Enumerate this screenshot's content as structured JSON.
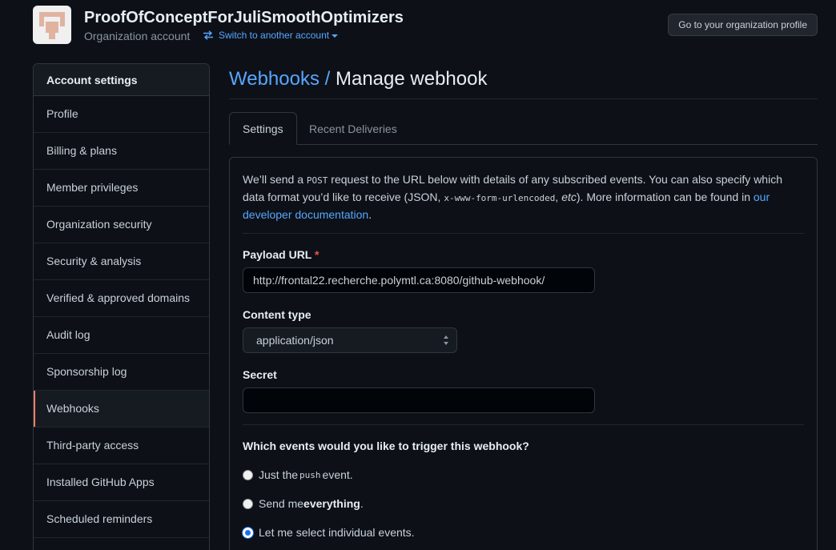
{
  "header": {
    "org_name": "ProofOfConceptForJuliSmoothOptimizers",
    "org_type": "Organization account",
    "switch_account_label": "Switch to another account",
    "profile_button_label": "Go to your organization profile"
  },
  "sidebar": {
    "heading": "Account settings",
    "items": [
      {
        "label": "Profile"
      },
      {
        "label": "Billing & plans"
      },
      {
        "label": "Member privileges"
      },
      {
        "label": "Organization security"
      },
      {
        "label": "Security & analysis"
      },
      {
        "label": "Verified & approved domains"
      },
      {
        "label": "Audit log"
      },
      {
        "label": "Sponsorship log"
      },
      {
        "label": "Webhooks",
        "selected": true
      },
      {
        "label": "Third-party access"
      },
      {
        "label": "Installed GitHub Apps"
      },
      {
        "label": "Scheduled reminders"
      }
    ]
  },
  "main": {
    "breadcrumb_link": "Webhooks",
    "breadcrumb_separator": "/",
    "title": "Manage webhook",
    "tabs": [
      {
        "label": "Settings",
        "active": true
      },
      {
        "label": "Recent Deliveries",
        "active": false
      }
    ],
    "intro": {
      "part1": "We’ll send a ",
      "method": "POST",
      "part2": " request to the URL below with details of any subscribed events. You can also specify which data format you’d like to receive (JSON, ",
      "format_code": "x-www-form-urlencoded",
      "part3": ", ",
      "etc": "etc",
      "part4": "). More information can be found in ",
      "link": "our developer documentation",
      "part5": "."
    },
    "payload_url": {
      "label": "Payload URL",
      "required_marker": "*",
      "value": "http://frontal22.recherche.polymtl.ca:8080/github-webhook/"
    },
    "content_type": {
      "label": "Content type",
      "selected": "application/json"
    },
    "secret": {
      "label": "Secret",
      "value": ""
    },
    "events": {
      "question": "Which events would you like to trigger this webhook?",
      "options": [
        {
          "prefix": "Just the ",
          "code": "push",
          "suffix": " event.",
          "checked": false
        },
        {
          "prefix": "Send me ",
          "bold": "everything",
          "suffix": ".",
          "checked": false
        },
        {
          "text": "Let me select individual events.",
          "checked": true
        }
      ]
    }
  },
  "colors": {
    "background": "#0d1117",
    "accent_link": "#58a6ff",
    "selected_marker": "#f78166",
    "required": "#f85149"
  }
}
